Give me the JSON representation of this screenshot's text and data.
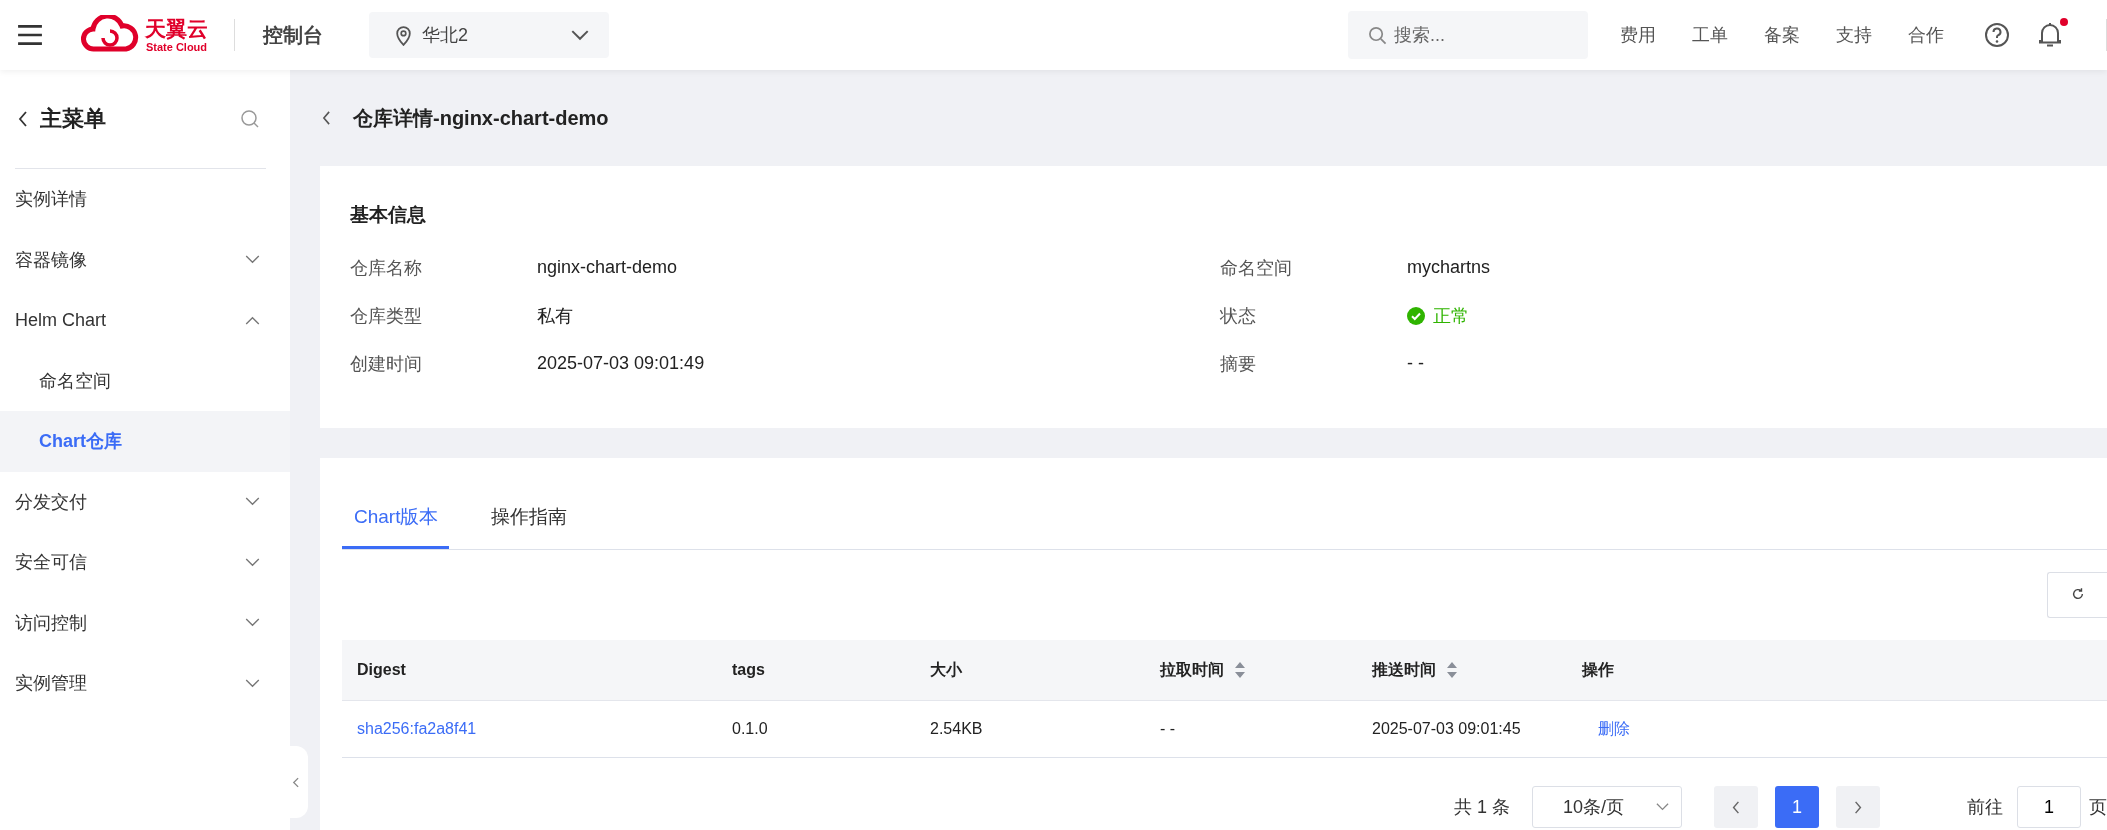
{
  "topbar": {
    "logo_text": "天翼云",
    "logo_sub": "State Cloud",
    "console": "控制台",
    "region": "华北2",
    "search": {
      "placeholder": "搜索..."
    },
    "links": [
      "费用",
      "工单",
      "备案",
      "支持",
      "合作"
    ],
    "has_unread": true
  },
  "sidebar": {
    "title": "主菜单",
    "items": [
      {
        "label": "实例详情",
        "kind": "link",
        "selected": false
      },
      {
        "label": "容器镜像",
        "kind": "group",
        "expanded": false,
        "selected": false
      },
      {
        "label": "Helm Chart",
        "kind": "group",
        "expanded": true,
        "selected": false,
        "children": [
          {
            "label": "命名空间",
            "selected": false
          },
          {
            "label": "Chart仓库",
            "selected": true
          }
        ]
      },
      {
        "label": "分发交付",
        "kind": "group",
        "expanded": false,
        "selected": false
      },
      {
        "label": "安全可信",
        "kind": "group",
        "expanded": false,
        "selected": false
      },
      {
        "label": "访问控制",
        "kind": "group",
        "expanded": false,
        "selected": false
      },
      {
        "label": "实例管理",
        "kind": "group",
        "expanded": false,
        "selected": false
      }
    ]
  },
  "page_title": "仓库详情-nginx-chart-demo",
  "basic_info": {
    "title": "基本信息",
    "fields": [
      {
        "label": "仓库名称",
        "value": "nginx-chart-demo",
        "kind": "text"
      },
      {
        "label": "命名空间",
        "value": "mychartns",
        "kind": "text"
      },
      {
        "label": "仓库类型",
        "value": "私有",
        "kind": "text"
      },
      {
        "label": "状态",
        "value": "正常",
        "kind": "status",
        "color": "#2fb400"
      },
      {
        "label": "创建时间",
        "value": "2025-07-03 09:01:49",
        "kind": "text"
      },
      {
        "label": "摘要",
        "value": "- -",
        "kind": "text"
      }
    ]
  },
  "tabs": [
    {
      "label": "Chart版本",
      "selected": true
    },
    {
      "label": "操作指南",
      "selected": false
    }
  ],
  "table": {
    "columns": [
      {
        "label": "Digest",
        "sortable": false
      },
      {
        "label": "tags",
        "sortable": false
      },
      {
        "label": "大小",
        "sortable": false
      },
      {
        "label": "拉取时间",
        "sortable": true
      },
      {
        "label": "推送时间",
        "sortable": true
      },
      {
        "label": "操作",
        "sortable": false
      }
    ],
    "rows": [
      {
        "digest": "sha256:fa2a8f41",
        "tags": "0.1.0",
        "size": "2.54KB",
        "pull_time": "- -",
        "push_time": "2025-07-03 09:01:45",
        "action": "删除"
      }
    ]
  },
  "pagination": {
    "total": "共 1 条",
    "page_size": "10条/页",
    "pages": [
      {
        "label": "1",
        "selected": true
      }
    ],
    "goto_label": "前往",
    "goto_value": "1",
    "goto_unit": "页"
  }
}
